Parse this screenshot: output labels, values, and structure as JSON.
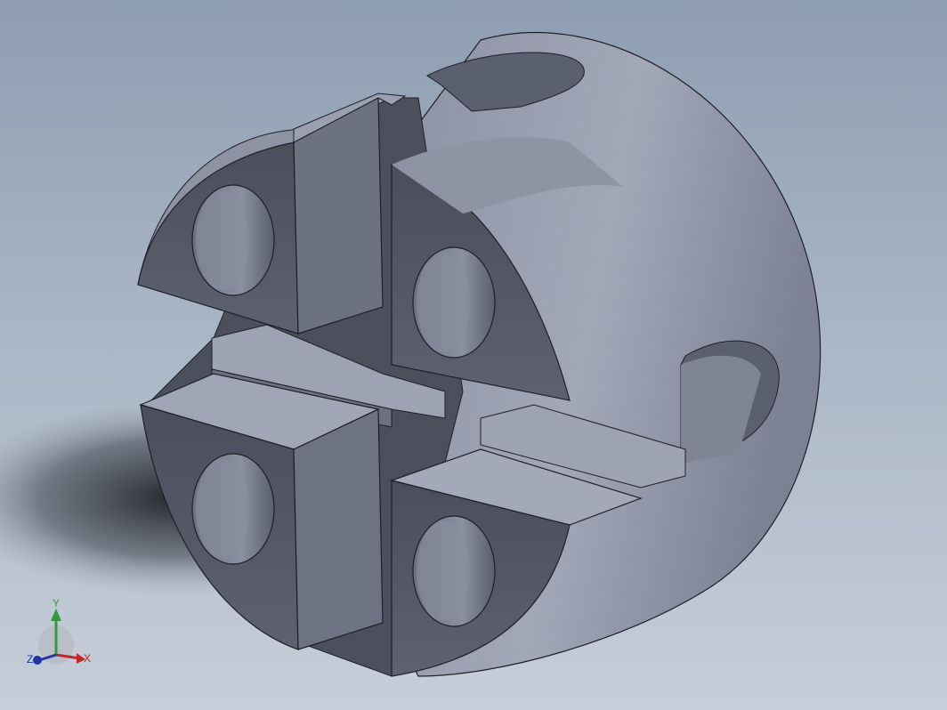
{
  "viewport": {
    "background_top": "#8e9db1",
    "background_bottom": "#c6ced9"
  },
  "model": {
    "part_color": "#7a7f8d",
    "edge_color": "#1e2028"
  },
  "triad": {
    "x_label": "X",
    "y_label": "Y",
    "z_label": "Z",
    "x_color": "#c0282a",
    "y_color": "#2e9e3a",
    "z_color": "#2036a8"
  }
}
